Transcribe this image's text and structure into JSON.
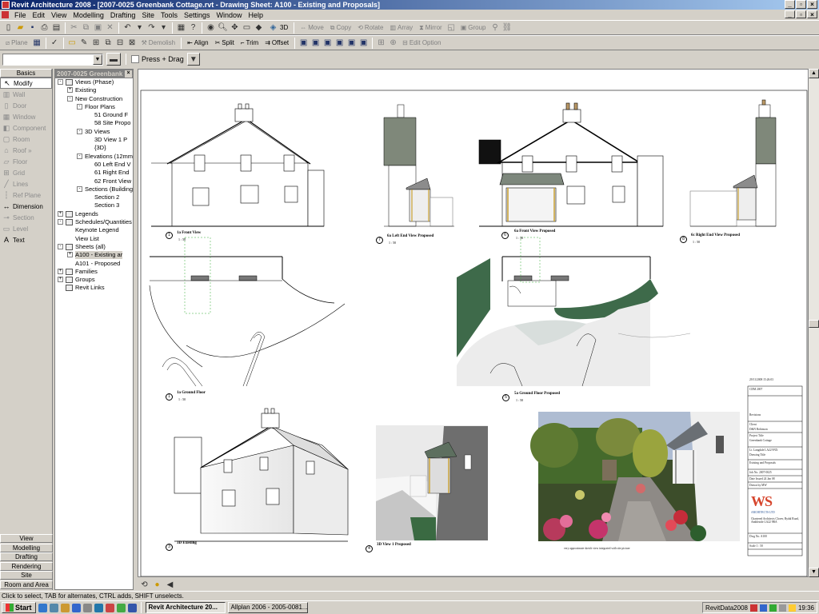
{
  "window": {
    "title": "Revit Architecture 2008 - [2007-0025 Greenbank Cottage.rvt - Drawing Sheet: A100 - Existing and Proposals]"
  },
  "menu": [
    "File",
    "Edit",
    "View",
    "Modelling",
    "Drafting",
    "Site",
    "Tools",
    "Settings",
    "Window",
    "Help"
  ],
  "toolbar2": {
    "tools": [
      "Move",
      "Copy",
      "Rotate",
      "Array",
      "Mirror",
      "Group"
    ],
    "view3d": "3D"
  },
  "toolbar3": {
    "plane": "Plane",
    "demolish": "Demolish",
    "align": "Align",
    "split": "Split",
    "trim": "Trim",
    "offset": "Offset",
    "edit_option": "Edit Option"
  },
  "options": {
    "press_drag": "Press + Drag"
  },
  "design_bar": {
    "header": "Basics",
    "items": [
      {
        "label": "Modify",
        "icon": "arrow-cursor-icon",
        "state": "active"
      },
      {
        "label": "Wall",
        "icon": "wall-icon",
        "state": "disabled"
      },
      {
        "label": "Door",
        "icon": "door-icon",
        "state": "disabled"
      },
      {
        "label": "Window",
        "icon": "window-icon",
        "state": "disabled"
      },
      {
        "label": "Component",
        "icon": "component-icon",
        "state": "disabled"
      },
      {
        "label": "Room",
        "icon": "room-icon",
        "state": "disabled"
      },
      {
        "label": "Roof »",
        "icon": "roof-icon",
        "state": "disabled"
      },
      {
        "label": "Floor",
        "icon": "floor-icon",
        "state": "disabled"
      },
      {
        "label": "Grid",
        "icon": "grid-icon",
        "state": "disabled"
      },
      {
        "label": "Lines",
        "icon": "lines-icon",
        "state": "disabled"
      },
      {
        "label": "Ref Plane",
        "icon": "ref-plane-icon",
        "state": "disabled"
      },
      {
        "label": "Dimension",
        "icon": "dimension-icon",
        "state": "enabled"
      },
      {
        "label": "Section",
        "icon": "section-icon",
        "state": "disabled"
      },
      {
        "label": "Level",
        "icon": "level-icon",
        "state": "disabled"
      },
      {
        "label": "Text",
        "icon": "text-icon",
        "state": "enabled"
      }
    ],
    "tabs": [
      "View",
      "Modelling",
      "Drafting",
      "Rendering",
      "Site",
      "Room and Area"
    ]
  },
  "project_browser": {
    "title": "2007-0025 Greenbank C...",
    "nodes": [
      {
        "label": "Views (Phase)",
        "level": 0,
        "toggle": "-",
        "icon": "views-icon"
      },
      {
        "label": "Existing",
        "level": 1,
        "toggle": "+"
      },
      {
        "label": "New Construction",
        "level": 1,
        "toggle": "-"
      },
      {
        "label": "Floor Plans",
        "level": 2,
        "toggle": "-"
      },
      {
        "label": "51 Ground F",
        "level": 3
      },
      {
        "label": "58 Site Propo",
        "level": 3
      },
      {
        "label": "3D Views",
        "level": 2,
        "toggle": "-"
      },
      {
        "label": "3D View 1 P",
        "level": 3
      },
      {
        "label": "{3D}",
        "level": 3
      },
      {
        "label": "Elevations (12mm",
        "level": 2,
        "toggle": "-"
      },
      {
        "label": "60 Left End V",
        "level": 3
      },
      {
        "label": "61 Right End",
        "level": 3
      },
      {
        "label": "62 Front View",
        "level": 3
      },
      {
        "label": "Sections (Building",
        "level": 2,
        "toggle": "-"
      },
      {
        "label": "Section 2",
        "level": 3
      },
      {
        "label": "Section 3",
        "level": 3
      },
      {
        "label": "Legends",
        "level": 0,
        "toggle": "+",
        "icon": "legend-icon"
      },
      {
        "label": "Schedules/Quantities",
        "level": 0,
        "toggle": "-",
        "icon": "schedule-icon"
      },
      {
        "label": "Keynote Legend",
        "level": 1
      },
      {
        "label": "View List",
        "level": 1
      },
      {
        "label": "Sheets (all)",
        "level": 0,
        "toggle": "-",
        "icon": "sheet-icon"
      },
      {
        "label": "A100 - Existing ar",
        "level": 1,
        "toggle": "+",
        "selected": true
      },
      {
        "label": "A101 - Proposed",
        "level": 1
      },
      {
        "label": "Families",
        "level": 0,
        "toggle": "+",
        "icon": "families-icon"
      },
      {
        "label": "Groups",
        "level": 0,
        "toggle": "+",
        "icon": "groups-icon"
      },
      {
        "label": "Revit Links",
        "level": 0,
        "icon": "links-icon"
      }
    ]
  },
  "sheet": {
    "views": [
      {
        "num": "1",
        "title": "1a Front View",
        "scale": "1 : 50"
      },
      {
        "num": "7",
        "title": "6a Left End View Proposed",
        "scale": "1 : 50"
      },
      {
        "num": "6",
        "title": "6a Front View Proposed",
        "scale": "1 : 50"
      },
      {
        "num": "8",
        "title": "6c Right End View Proposed",
        "scale": "1 : 50"
      },
      {
        "num": "1",
        "title": "1a Ground Floor",
        "scale": "1 : 50"
      },
      {
        "num": "5",
        "title": "5a Ground Floor Proposed",
        "scale": "1 : 50"
      },
      {
        "num": "3",
        "title": "3D Existing",
        "scale": ""
      },
      {
        "num": "4",
        "title": "3D View 1 Proposed",
        "scale": ""
      }
    ],
    "photo_caption": "very approximate sketch view integrated with site picture",
    "title_block": {
      "date_stamp": "29/11/2008 15:26:03",
      "rows": [
        "CDM 2007",
        "Revisions",
        "Client",
        "D&N Robinson",
        "Project Title",
        "Greenbank Cottage",
        "Lt. Langdale LA22 9NX",
        "Drawing Title",
        "Existing and Proposals",
        "Job No. 2007-0025",
        "Date Issued 24 Jan 08",
        "Drawn by MW",
        "Dwg No. A100",
        "Scale 1 : 50"
      ],
      "firm_logo": "WS",
      "firm_name": "ARCHITECTS LTD",
      "firm_address": "Chartered Architects Clover, Rydal Road, Ambleside LA22 9BA"
    }
  },
  "status_text": "Click to select, TAB for alternates, CTRL adds, SHIFT unselects.",
  "taskbar": {
    "start": "Start",
    "tasks": [
      {
        "label": "Revit Architecture 20...",
        "active": true
      },
      {
        "label": "Allplan 2006 - 2005-0081...",
        "active": false
      }
    ],
    "tray_label": "RevitData2008",
    "clock": "19:36"
  }
}
